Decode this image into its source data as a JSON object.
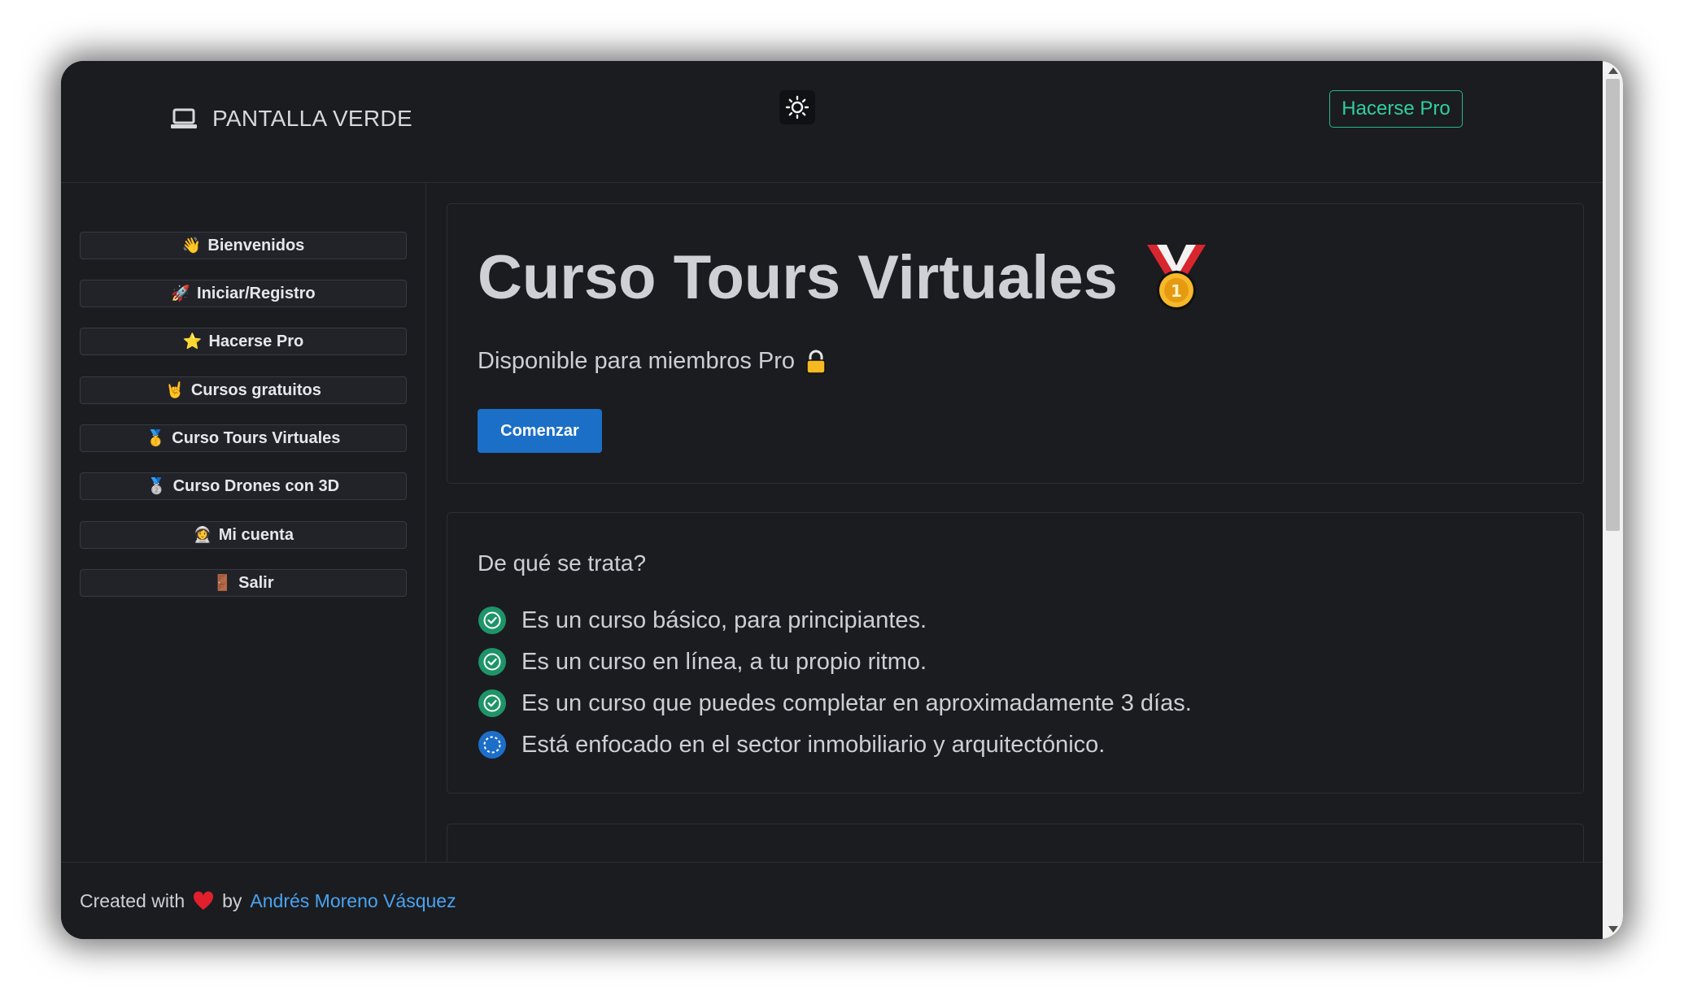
{
  "header": {
    "brand": "PANTALLA VERDE",
    "brand_icon": "laptop-icon",
    "theme_icon": "sun-icon",
    "pro_button": "Hacerse Pro"
  },
  "sidebar": {
    "items": [
      {
        "icon": "👋",
        "label": "Bienvenidos"
      },
      {
        "icon": "🚀",
        "label": "Iniciar/Registro"
      },
      {
        "icon": "⭐",
        "label": "Hacerse Pro"
      },
      {
        "icon": "🤘",
        "label": "Cursos gratuitos"
      },
      {
        "icon": "🥇",
        "label": "Curso Tours Virtuales"
      },
      {
        "icon": "🥈",
        "label": "Curso Drones con 3D"
      },
      {
        "icon": "👩‍🚀",
        "label": "Mi cuenta"
      },
      {
        "icon": "🚪",
        "label": "Salir"
      }
    ]
  },
  "hero": {
    "title": "Curso Tours Virtuales",
    "title_icon": "medal-icon",
    "subtitle": "Disponible para miembros Pro",
    "subtitle_icon": "lock-icon",
    "button": "Comenzar"
  },
  "about": {
    "heading": "De qué se trata?",
    "features": [
      {
        "text": "Es un curso básico, para principiantes.",
        "icon": "check-circle-icon"
      },
      {
        "text": "Es un curso en línea, a tu propio ritmo.",
        "icon": "check-circle-icon"
      },
      {
        "text": "Es un curso que puedes completar en aproximadamente 3 días.",
        "icon": "check-circle-icon"
      },
      {
        "text": "Está enfocado en el sector inmobiliario y arquitectónico.",
        "icon": "dashed-circle-icon"
      }
    ]
  },
  "footer": {
    "prefix": "Created with",
    "heart_icon": "heart-icon",
    "by": "by",
    "author": "Andrés Moreno Vásquez"
  },
  "colors": {
    "background": "#1b1c20",
    "accent_green": "#25b88a",
    "accent_blue": "#1b6fc6",
    "link": "#4aa3f0"
  }
}
